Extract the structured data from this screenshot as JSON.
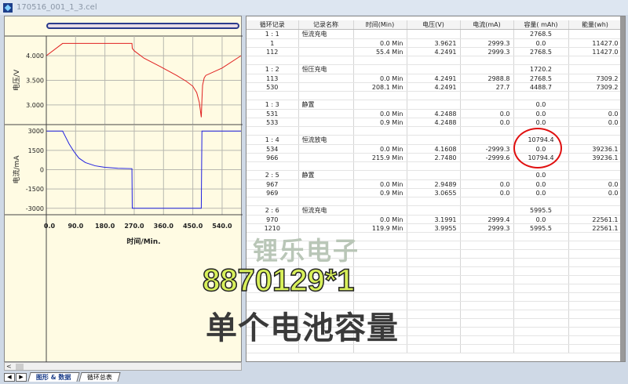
{
  "window": {
    "title": "170516_001_1_3.cel"
  },
  "chart_data": [
    {
      "type": "line",
      "ylabel": "电压/V",
      "xlabel": "时间/Min.",
      "xlim": [
        0,
        598
      ],
      "ylim": [
        2.6,
        4.4
      ],
      "yticks": [
        "4.000",
        "3.500",
        "3.000"
      ],
      "ytick_values": [
        4.0,
        3.5,
        3.0
      ],
      "xticks": [
        "0.0",
        "90.0",
        "180.0",
        "270.0",
        "360.0",
        "450.0",
        "540.0"
      ],
      "xtick_values": [
        0,
        90,
        180,
        270,
        360,
        450,
        540
      ],
      "color": "#e02020",
      "grid": true,
      "x": [
        0,
        50,
        263,
        264,
        270,
        300,
        350,
        400,
        430,
        450,
        462,
        470,
        476,
        478,
        480,
        485,
        490,
        540,
        598
      ],
      "y": [
        4.0,
        4.25,
        4.25,
        4.15,
        4.1,
        3.95,
        3.78,
        3.6,
        3.48,
        3.38,
        3.25,
        3.05,
        2.75,
        3.1,
        3.4,
        3.55,
        3.6,
        3.75,
        4.0
      ]
    },
    {
      "type": "line",
      "ylabel": "电流/mA",
      "xlabel": "时间/Min.",
      "xlim": [
        0,
        598
      ],
      "ylim": [
        -3500,
        3500
      ],
      "yticks": [
        "3000",
        "1500",
        "0",
        "-1500",
        "-3000"
      ],
      "ytick_values": [
        3000,
        1500,
        0,
        -1500,
        -3000
      ],
      "color": "#2020e0",
      "grid": true,
      "x": [
        0,
        50,
        60,
        70,
        85,
        100,
        120,
        150,
        180,
        220,
        263,
        264,
        476,
        478,
        598
      ],
      "y": [
        3000,
        3000,
        2500,
        2000,
        1400,
        900,
        550,
        300,
        180,
        110,
        80,
        -3000,
        -3000,
        3000,
        3000
      ]
    }
  ],
  "table": {
    "headers": [
      "循环记录",
      "记录名称",
      "时间(Min)",
      "电压(V)",
      "电流(mA)",
      "容量( mAh)",
      "能量(wh)"
    ],
    "rows": [
      [
        "1 : 1",
        "恒流充电",
        "",
        "",
        "",
        "2768.5",
        ""
      ],
      [
        "1",
        "",
        "0.0 Min",
        "3.9621",
        "2999.3",
        "0.0",
        "11427.0"
      ],
      [
        "112",
        "",
        "55.4 Min",
        "4.2491",
        "2999.3",
        "2768.5",
        "11427.0"
      ],
      [
        "",
        "",
        "",
        "",
        "",
        "",
        ""
      ],
      [
        "1 : 2",
        "恒压充电",
        "",
        "",
        "",
        "1720.2",
        ""
      ],
      [
        "113",
        "",
        "0.0 Min",
        "4.2491",
        "2988.8",
        "2768.5",
        "7309.2"
      ],
      [
        "530",
        "",
        "208.1 Min",
        "4.2491",
        "27.7",
        "4488.7",
        "7309.2"
      ],
      [
        "",
        "",
        "",
        "",
        "",
        "",
        ""
      ],
      [
        "1 : 3",
        "静置",
        "",
        "",
        "",
        "0.0",
        ""
      ],
      [
        "531",
        "",
        "0.0 Min",
        "4.2488",
        "0.0",
        "0.0",
        "0.0"
      ],
      [
        "533",
        "",
        "0.9 Min",
        "4.2488",
        "0.0",
        "0.0",
        "0.0"
      ],
      [
        "",
        "",
        "",
        "",
        "",
        "",
        ""
      ],
      [
        "1 : 4",
        "恒流放电",
        "",
        "",
        "",
        "10794.4",
        ""
      ],
      [
        "534",
        "",
        "0.0 Min",
        "4.1608",
        "-2999.3",
        "0.0",
        "39236.1"
      ],
      [
        "966",
        "",
        "215.9 Min",
        "2.7480",
        "-2999.6",
        "10794.4",
        "39236.1"
      ],
      [
        "",
        "",
        "",
        "",
        "",
        "",
        ""
      ],
      [
        "2 : 5",
        "静置",
        "",
        "",
        "",
        "0.0",
        ""
      ],
      [
        "967",
        "",
        "0.0 Min",
        "2.9489",
        "0.0",
        "0.0",
        "0.0"
      ],
      [
        "969",
        "",
        "0.9 Min",
        "3.0655",
        "0.0",
        "0.0",
        "0.0"
      ],
      [
        "",
        "",
        "",
        "",
        "",
        "",
        ""
      ],
      [
        "2 : 6",
        "恒流充电",
        "",
        "",
        "",
        "5995.5",
        ""
      ],
      [
        "970",
        "",
        "0.0 Min",
        "3.1991",
        "2999.4",
        "0.0",
        "22561.1"
      ],
      [
        "1210",
        "",
        "119.9 Min",
        "3.9955",
        "2999.3",
        "5995.5",
        "22561.1"
      ]
    ],
    "empty_rows": 14
  },
  "tabs": [
    "图形 & 数据",
    "循环总表"
  ],
  "overlay": {
    "line1": "锂乐电子",
    "line2": "8870129*1",
    "line3": "单个电池容量"
  },
  "colors": {
    "highlight": "#e01010",
    "voltage": "#e02020",
    "current": "#2020e0"
  }
}
